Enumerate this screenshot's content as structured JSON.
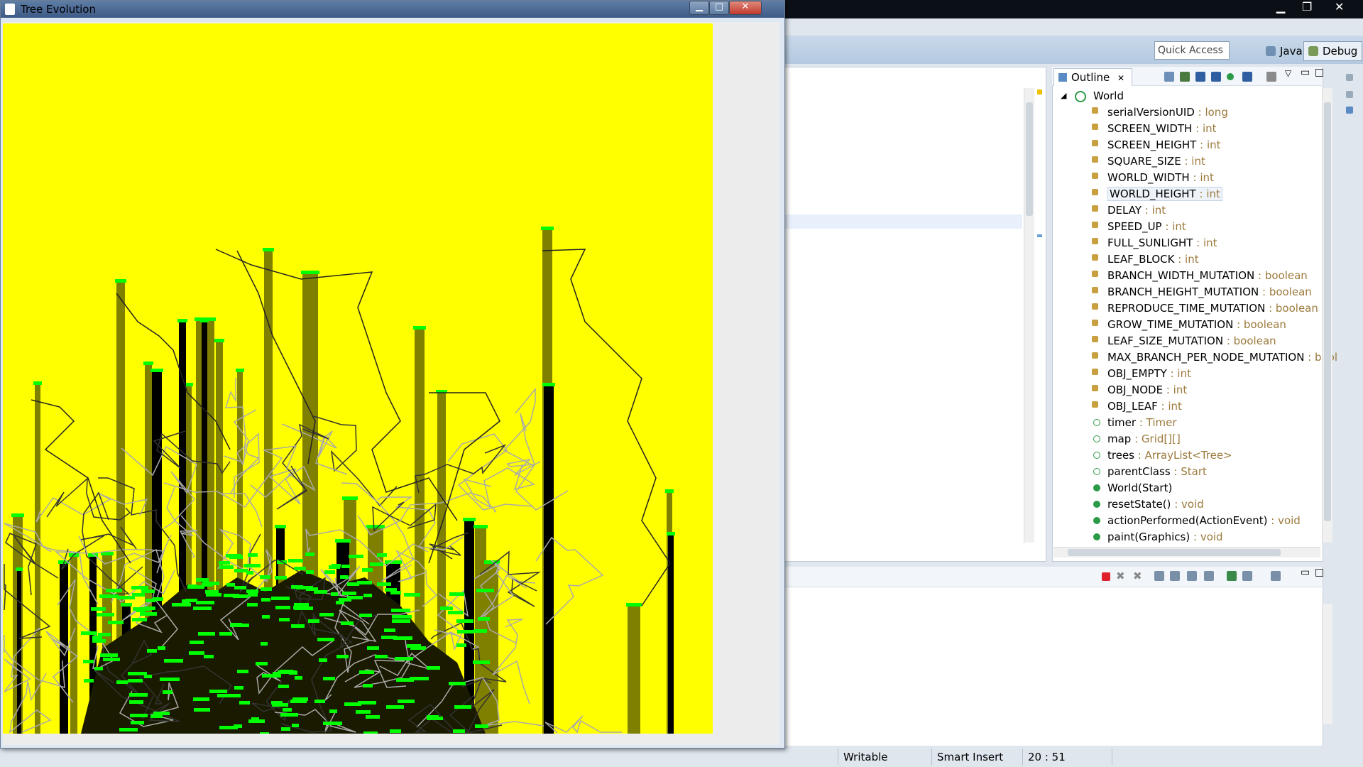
{
  "os": {
    "colors": {
      "taskbar": "#0b0f16"
    }
  },
  "app_window": {
    "title": "Tree Evolution",
    "icon": "java-cup-icon",
    "buttons": {
      "minimize": "minimize-icon",
      "maximize": "maximize-icon",
      "close": "close-icon"
    },
    "canvas": {
      "background": "#ffff00",
      "trunk_color": "#808000",
      "dead_trunk_color": "#000000",
      "leaf_color": "#00ff00",
      "root_color_dark": "#333333",
      "root_color_light": "#aaaaaa"
    }
  },
  "eclipse": {
    "quick_access": {
      "placeholder": "Quick Access"
    },
    "perspectives": [
      {
        "label": "Java",
        "icon": "java-perspective-icon"
      },
      {
        "label": "Debug",
        "icon": "debug-perspective-icon",
        "active": true
      }
    ],
    "outline": {
      "tab_label": "Outline",
      "root": "World",
      "members": [
        {
          "name": "serialVersionUID",
          "type": ": long"
        },
        {
          "name": "SCREEN_WIDTH",
          "type": ": int"
        },
        {
          "name": "SCREEN_HEIGHT",
          "type": ": int"
        },
        {
          "name": "SQUARE_SIZE",
          "type": ": int"
        },
        {
          "name": "WORLD_WIDTH",
          "type": ": int"
        },
        {
          "name": "WORLD_HEIGHT",
          "type": ": int",
          "selected": true
        },
        {
          "name": "DELAY",
          "type": ": int"
        },
        {
          "name": "SPEED_UP",
          "type": ": int"
        },
        {
          "name": "FULL_SUNLIGHT",
          "type": ": int"
        },
        {
          "name": "LEAF_BLOCK",
          "type": ": int"
        },
        {
          "name": "BRANCH_WIDTH_MUTATION",
          "type": ": boolean"
        },
        {
          "name": "BRANCH_HEIGHT_MUTATION",
          "type": ": boolean"
        },
        {
          "name": "REPRODUCE_TIME_MUTATION",
          "type": ": boolean"
        },
        {
          "name": "GROW_TIME_MUTATION",
          "type": ": boolean"
        },
        {
          "name": "LEAF_SIZE_MUTATION",
          "type": ": boolean"
        },
        {
          "name": "MAX_BRANCH_PER_NODE_MUTATION",
          "type": ": bool"
        },
        {
          "name": "OBJ_EMPTY",
          "type": ": int"
        },
        {
          "name": "OBJ_NODE",
          "type": ": int"
        },
        {
          "name": "OBJ_LEAF",
          "type": ": int"
        },
        {
          "name": "timer",
          "type": ": Timer"
        },
        {
          "name": "map",
          "type": ": Grid[][]"
        },
        {
          "name": "trees",
          "type": ": ArrayList<Tree>"
        },
        {
          "name": "parentClass",
          "type": ": Start"
        },
        {
          "name": "World(Start)",
          "type": ""
        },
        {
          "name": "resetState()",
          "type": ": void"
        },
        {
          "name": "actionPerformed(ActionEvent)",
          "type": ": void"
        },
        {
          "name": "paint(Graphics)",
          "type": ": void"
        }
      ]
    },
    "status_bar": {
      "mode": "Writable",
      "insert": "Smart Insert",
      "position": "20 : 51"
    }
  }
}
